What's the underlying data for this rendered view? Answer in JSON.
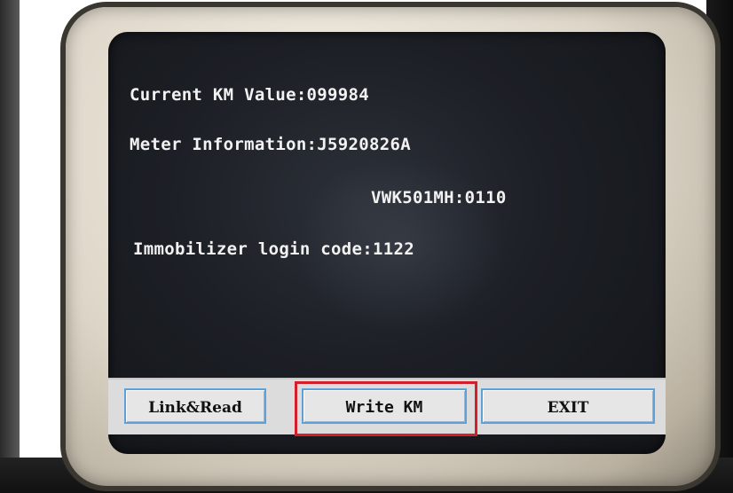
{
  "screen": {
    "current_km": "Current KM Value:099984",
    "meter_info": "Meter Information:J5920826A",
    "vwk_line": "VWK501MH:0110",
    "immobilizer": "Immobilizer login code:1122"
  },
  "buttons": {
    "link_read": "Link&Read",
    "write_km": "Write KM",
    "exit": "EXIT"
  },
  "colors": {
    "screen_background": "#1c1f25",
    "screen_text": "#f2f2f2",
    "button_face": "#e6e6e6",
    "button_border": "#5ea1d9",
    "highlight": "#d21f2b",
    "bezel": "#ddd6c8"
  }
}
